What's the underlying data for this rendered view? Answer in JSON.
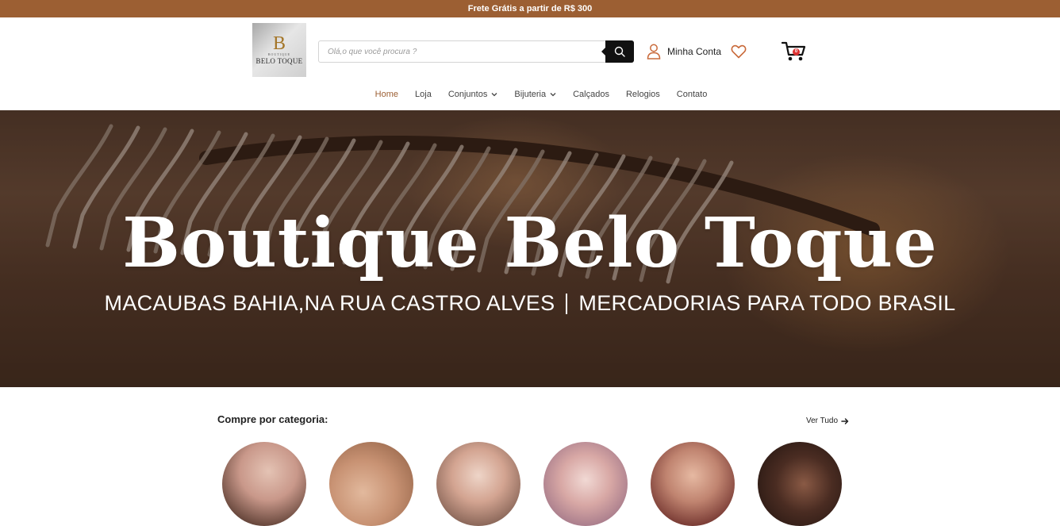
{
  "topbar": {
    "text": "Frete Grátis a partir de R$ 300"
  },
  "logo": {
    "letter": "B",
    "subtitle": "BOUTIQUE",
    "name": "BELO TOQUE"
  },
  "search": {
    "placeholder": "Olá,o que você procura ?",
    "value": ""
  },
  "account": {
    "label": "Minha Conta"
  },
  "cart": {
    "count": "0"
  },
  "nav": {
    "items": [
      {
        "label": "Home",
        "active": true
      },
      {
        "label": "Loja"
      },
      {
        "label": "Conjuntos",
        "dropdown": true
      },
      {
        "label": "Bijuteria",
        "dropdown": true
      },
      {
        "label": "Calçados"
      },
      {
        "label": "Relogios"
      },
      {
        "label": "Contato"
      }
    ]
  },
  "hero": {
    "title": "Boutique Belo  Toque",
    "subtitle_left": "MACAUBAS BAHIA,NA RUA CASTRO ALVES",
    "subtitle_right": "MERCADORIAS PARA TODO BRASIL"
  },
  "categories": {
    "title": "Compre por categoria:",
    "see_all": "Ver Tudo"
  },
  "colors": {
    "brand": "#9c5f33",
    "accent": "#c96a3a",
    "dark": "#111111"
  }
}
